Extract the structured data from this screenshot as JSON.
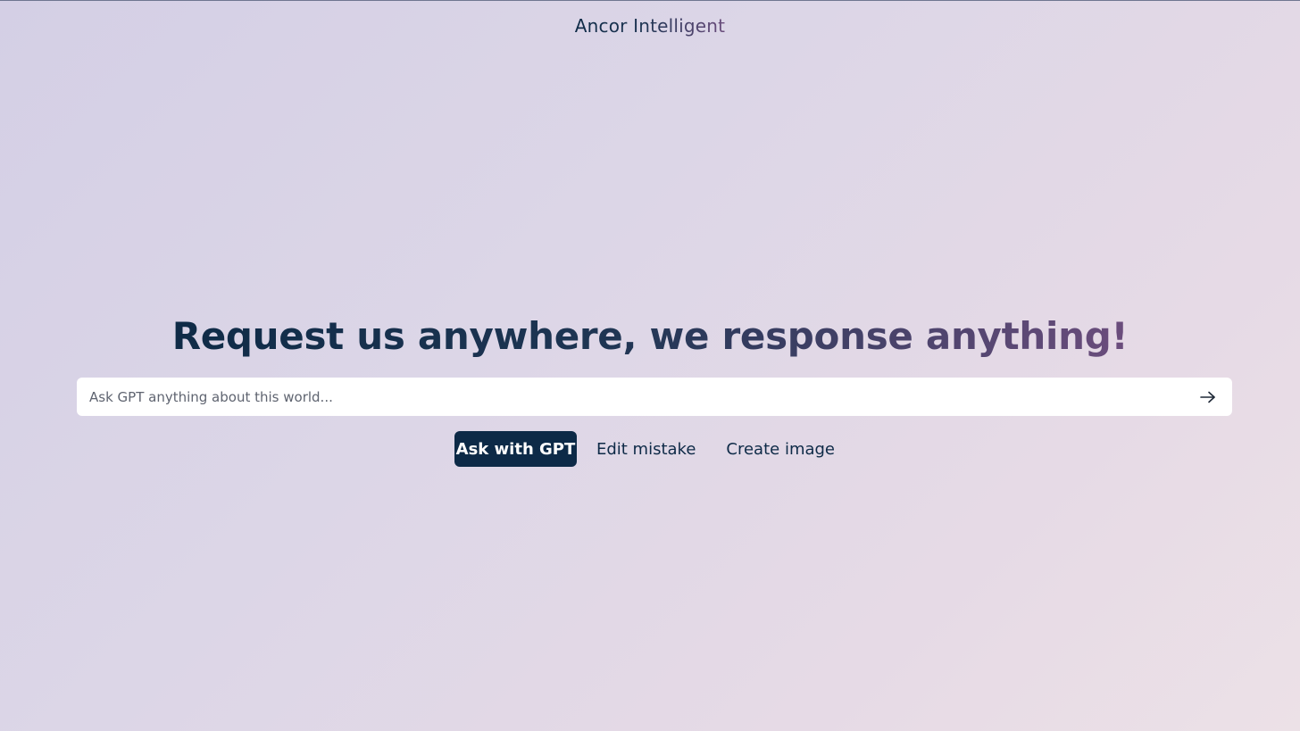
{
  "header": {
    "brand": "Ancor Intelligent"
  },
  "hero": {
    "headline": "Request us anywhere, we response anything!"
  },
  "search": {
    "placeholder": "Ask GPT anything about this world...",
    "value": "",
    "submit_icon": "arrow-right-icon"
  },
  "actions": {
    "ask_label": "Ask with GPT",
    "edit_label": "Edit mistake",
    "image_label": "Create image"
  },
  "colors": {
    "primary": "#0d2a47",
    "accent": "#6b4d7d",
    "background_start": "#d4cfe5",
    "background_end": "#ece1e7"
  }
}
